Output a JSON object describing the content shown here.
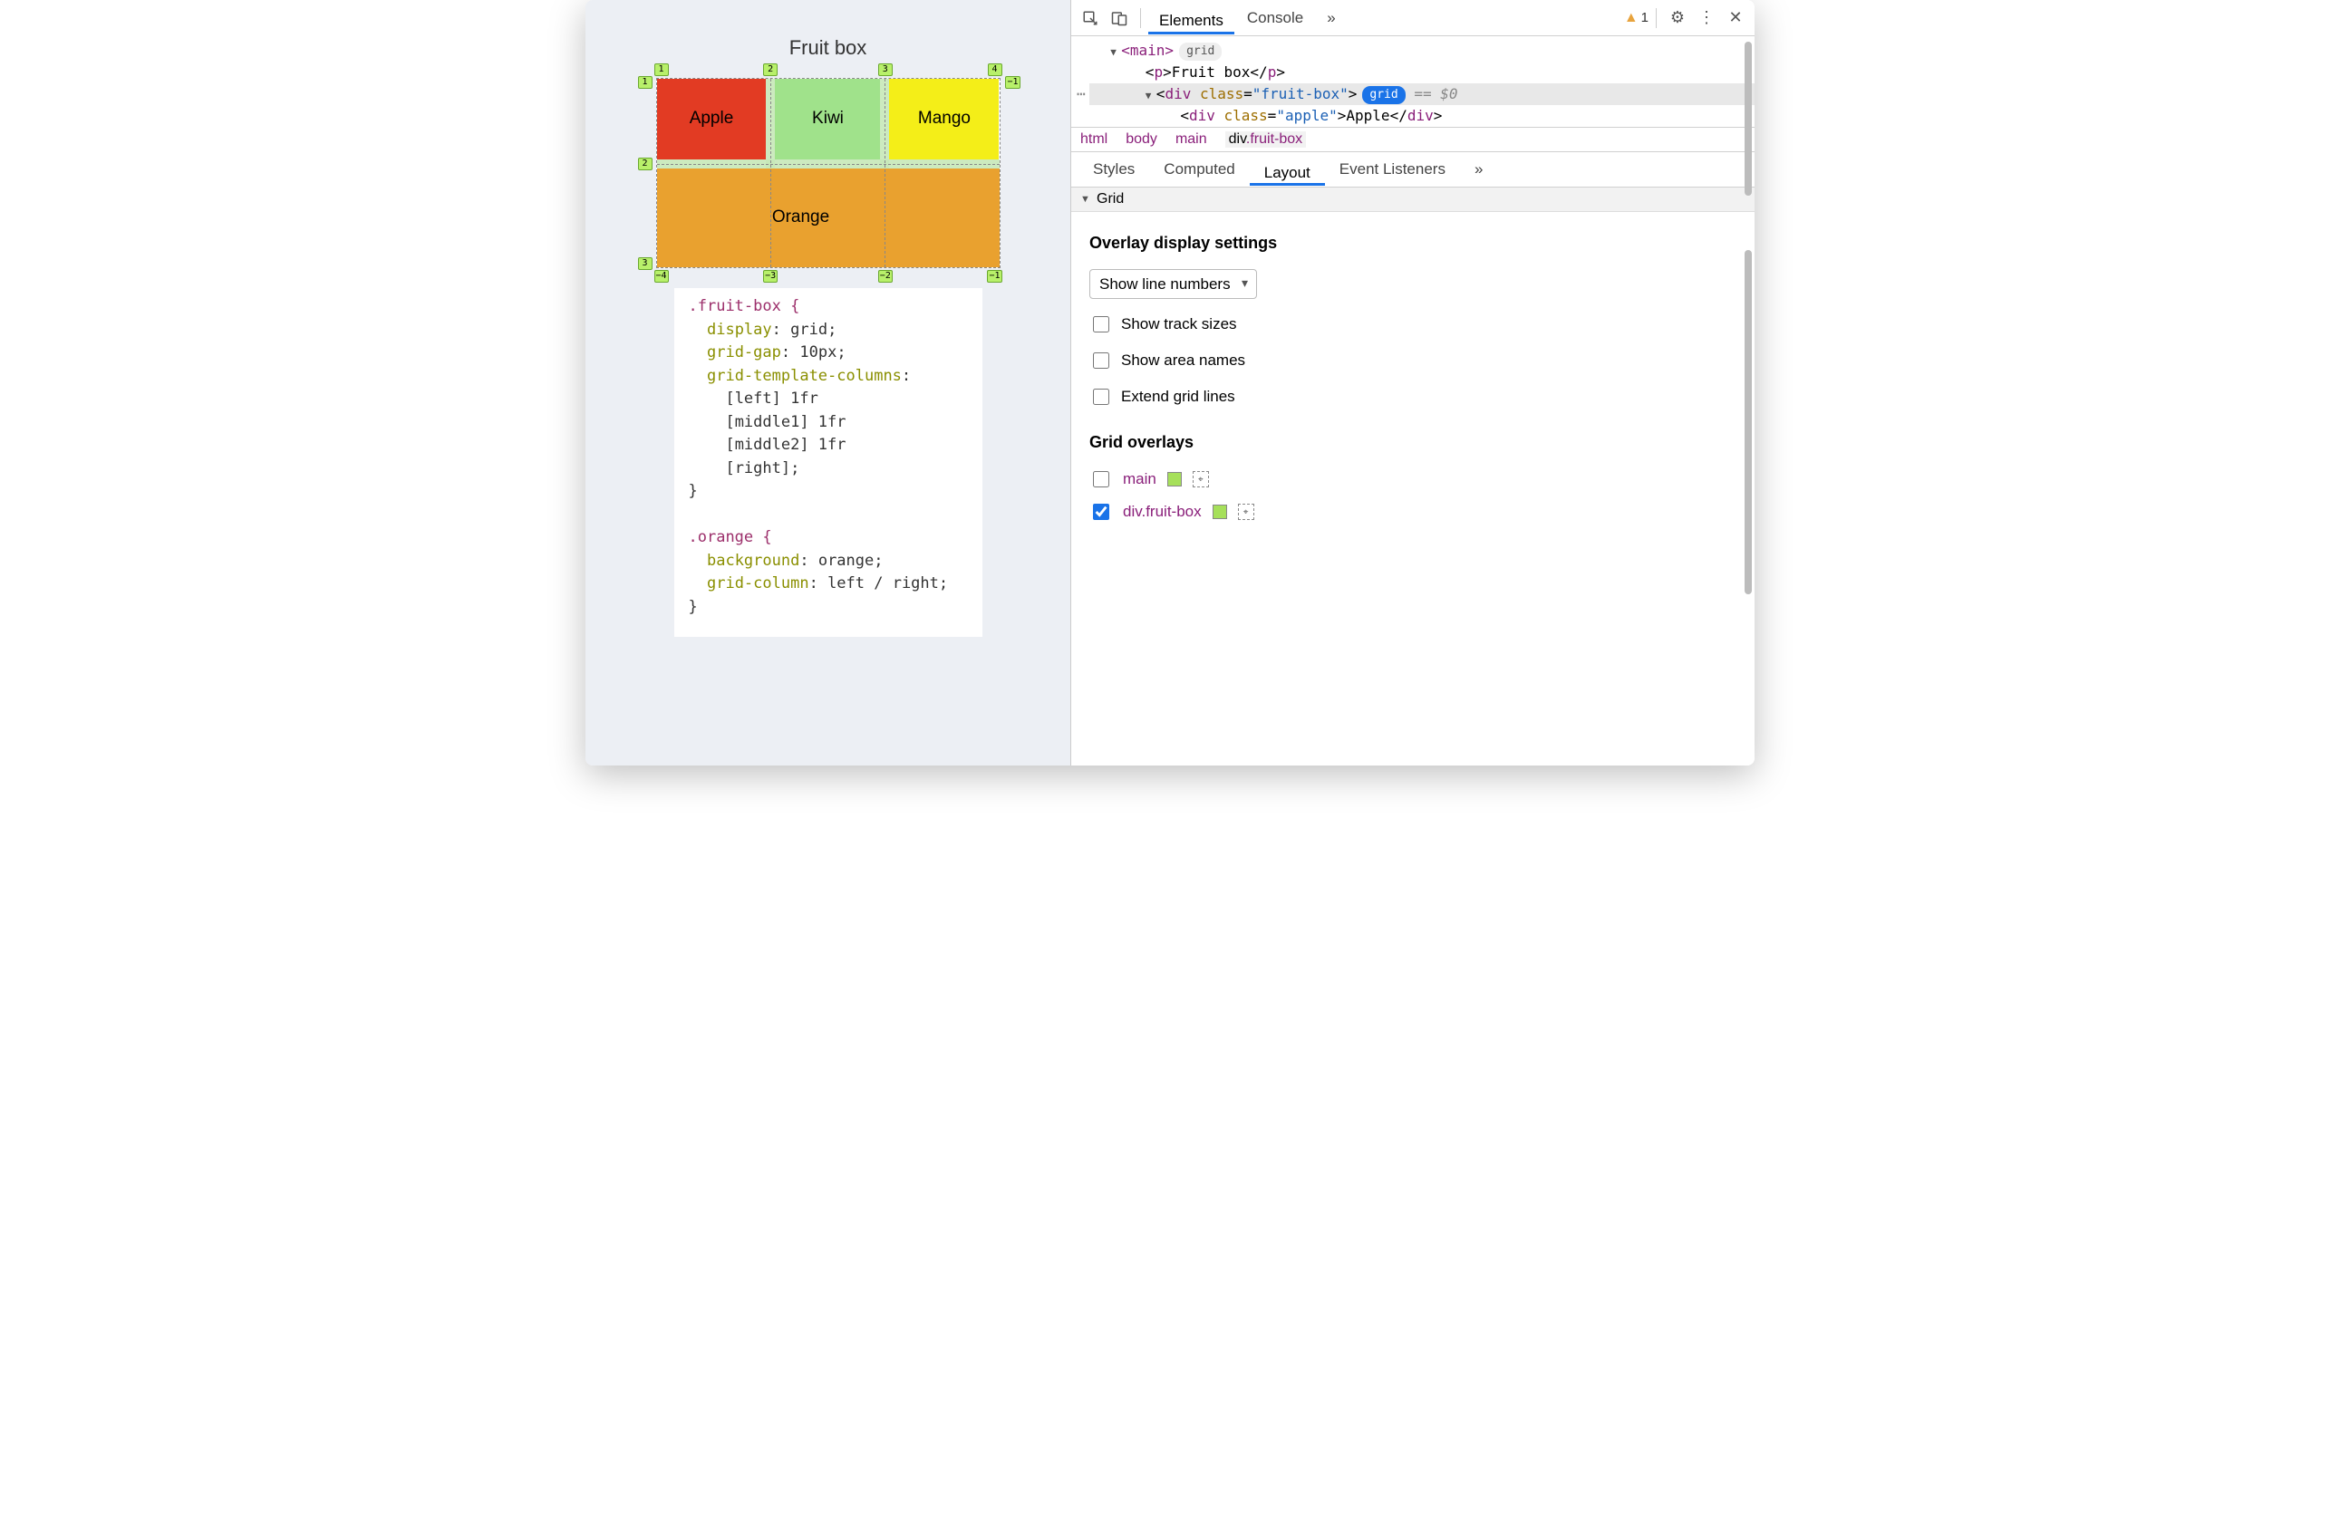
{
  "page": {
    "title": "Fruit box",
    "cells": {
      "apple": "Apple",
      "kiwi": "Kiwi",
      "mango": "Mango",
      "orange": "Orange"
    },
    "top_col_badges": [
      "1",
      "2",
      "3",
      "4"
    ],
    "bottom_col_badges": [
      "−4",
      "−3",
      "−2",
      "−1"
    ],
    "left_row_badges": [
      "1",
      "2",
      "3"
    ],
    "right_row_badges": [
      "−1"
    ],
    "css": {
      "sel1": ".fruit-box {",
      "p1a": "display",
      "p1av": "grid",
      "p1b": "grid-gap",
      "p1bv": "10px",
      "p1c": "grid-template-columns",
      "p1c1": "[left] 1fr",
      "p1c2": "[middle1] 1fr",
      "p1c3": "[middle2] 1fr",
      "p1c4": "[right]",
      "close1": "}",
      "sel2": ".orange {",
      "p2a": "background",
      "p2av": "orange",
      "p2b": "grid-column",
      "p2bv": "left / right",
      "close2": "}"
    }
  },
  "devtools": {
    "tabs": {
      "elements": "Elements",
      "console": "Console",
      "more": "»"
    },
    "warn_count": "1",
    "dom": {
      "main_open": "<main>",
      "main_badge": "grid",
      "p_line": "<p>Fruit box</p>",
      "div_open_pre": "<div ",
      "div_class_attr": "class",
      "div_class_val": "\"fruit-box\"",
      "div_open_post": ">",
      "div_badge": "grid",
      "eq0": " == $0",
      "apple_line_pre": "<div ",
      "apple_class_attr": "class",
      "apple_class_val": "\"apple\"",
      "apple_mid": ">Apple</div>"
    },
    "crumbs": [
      "html",
      "body",
      "main",
      "div.fruit-box"
    ],
    "subtabs": {
      "styles": "Styles",
      "computed": "Computed",
      "layout": "Layout",
      "events": "Event Listeners",
      "more": "»"
    },
    "grid_header": "Grid",
    "overlay_settings_title": "Overlay display settings",
    "line_select": "Show line numbers",
    "checks": {
      "track": "Show track sizes",
      "area": "Show area names",
      "extend": "Extend grid lines"
    },
    "overlays_title": "Grid overlays",
    "overlays": [
      {
        "checked": false,
        "label": "main"
      },
      {
        "checked": true,
        "label": "div.fruit-box"
      }
    ]
  }
}
